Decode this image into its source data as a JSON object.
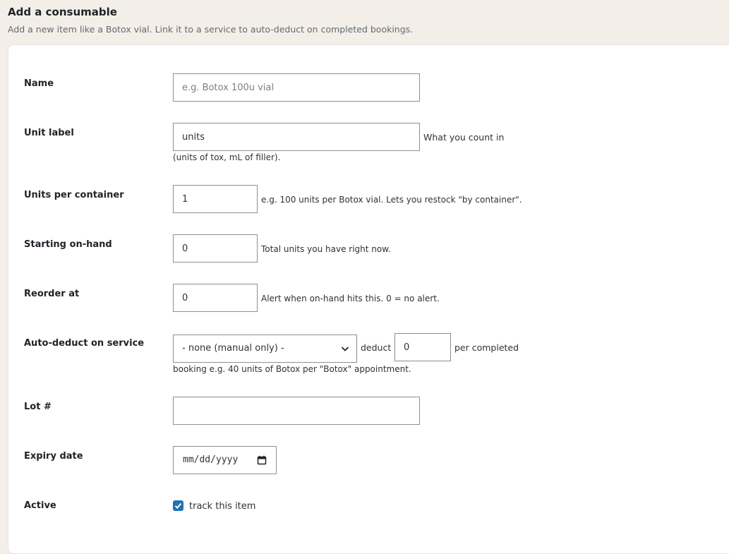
{
  "header": {
    "title": "Add a consumable",
    "subtitle": "Add a new item like a Botox vial. Link it to a service to auto-deduct on completed bookings."
  },
  "fields": {
    "name": {
      "label": "Name",
      "placeholder": "e.g. Botox 100u vial",
      "value": ""
    },
    "unit_label": {
      "label": "Unit label",
      "value": "units",
      "help_1": "What you count in",
      "help_2": "(units of tox, mL of filler)."
    },
    "units_per_container": {
      "label": "Units per container",
      "value": "1",
      "help": "e.g. 100 units per Botox vial. Lets you restock \"by container\"."
    },
    "starting_on_hand": {
      "label": "Starting on-hand",
      "value": "0",
      "help": "Total units you have right now."
    },
    "reorder_at": {
      "label": "Reorder at",
      "value": "0",
      "help": "Alert when on-hand hits this. 0 = no alert."
    },
    "auto_deduct": {
      "label": "Auto-deduct on service",
      "selected": "- none (manual only) -",
      "deduct_label": "deduct",
      "deduct_value": "0",
      "per_label": "per completed",
      "help": "booking e.g. 40 units of Botox per \"Botox\" appointment."
    },
    "lot": {
      "label": "Lot #",
      "value": ""
    },
    "expiry": {
      "label": "Expiry date",
      "placeholder": "mm/dd/yyyy"
    },
    "active": {
      "label": "Active",
      "checkbox_label": "track this item",
      "checked": true
    }
  },
  "colors": {
    "accent": "#2271b1",
    "page_bg": "#f3efe8",
    "border": "#8c8f94"
  }
}
